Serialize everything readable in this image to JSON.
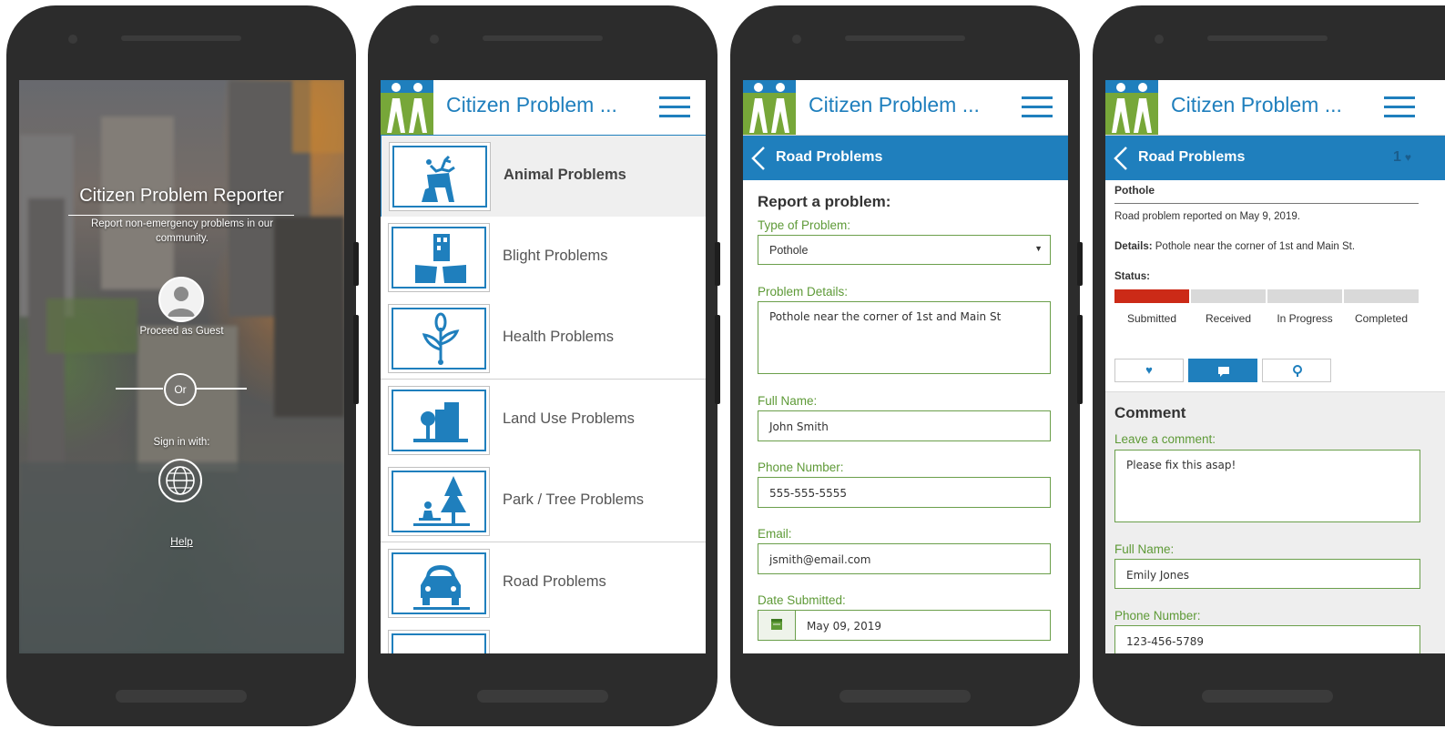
{
  "colors": {
    "brand_blue": "#1f7fbd",
    "brand_green": "#77a739",
    "label_green": "#5e9a37",
    "status_red": "#cc2a17",
    "status_gray": "#d9d9d9"
  },
  "login": {
    "title": "Citizen Problem Reporter",
    "subtitle": "Report non-emergency problems in our community.",
    "guest_label": "Proceed as Guest",
    "or_label": "Or",
    "sign_in_label": "Sign in with:",
    "help_label": "Help"
  },
  "header": {
    "app_title": "Citizen Problem ..."
  },
  "categories": {
    "items": [
      {
        "label": "Animal Problems",
        "icon": "deer-icon",
        "selected": true
      },
      {
        "label": "Blight Problems",
        "icon": "damaged-building-icon"
      },
      {
        "label": "Health Problems",
        "icon": "plant-icon"
      },
      {
        "label": "Land Use Problems",
        "icon": "tree-building-icon"
      },
      {
        "label": "Park / Tree Problems",
        "icon": "park-bench-tree-icon"
      },
      {
        "label": "Road Problems",
        "icon": "car-icon"
      }
    ]
  },
  "report_form": {
    "nav_title": "Road Problems",
    "heading": "Report a problem:",
    "type_label": "Type of Problem:",
    "type_value": "Pothole",
    "details_label": "Problem Details:",
    "details_value": "Pothole near the corner of 1st and Main St",
    "name_label": "Full Name:",
    "name_value": "John Smith",
    "phone_label": "Phone Number:",
    "phone_value": "555-555-5555",
    "email_label": "Email:",
    "email_value": "jsmith@email.com",
    "date_label": "Date Submitted:",
    "date_value": "May 09, 2019"
  },
  "detail": {
    "nav_title": "Road Problems",
    "like_count": "1",
    "problem_title": "Pothole",
    "reported_text": "Road problem reported on May 9, 2019.",
    "details_label": "Details:",
    "details_text": "Pothole near the corner of 1st and Main St.",
    "status_label": "Status:",
    "status_steps": [
      "Submitted",
      "Received",
      "In Progress",
      "Completed"
    ],
    "status_current_index": 0,
    "comment_heading": "Comment",
    "comment_label": "Leave a comment:",
    "comment_value": "Please fix this asap!",
    "name_label": "Full Name:",
    "name_value": "Emily Jones",
    "phone_label": "Phone Number:",
    "phone_value": "123-456-5789"
  }
}
